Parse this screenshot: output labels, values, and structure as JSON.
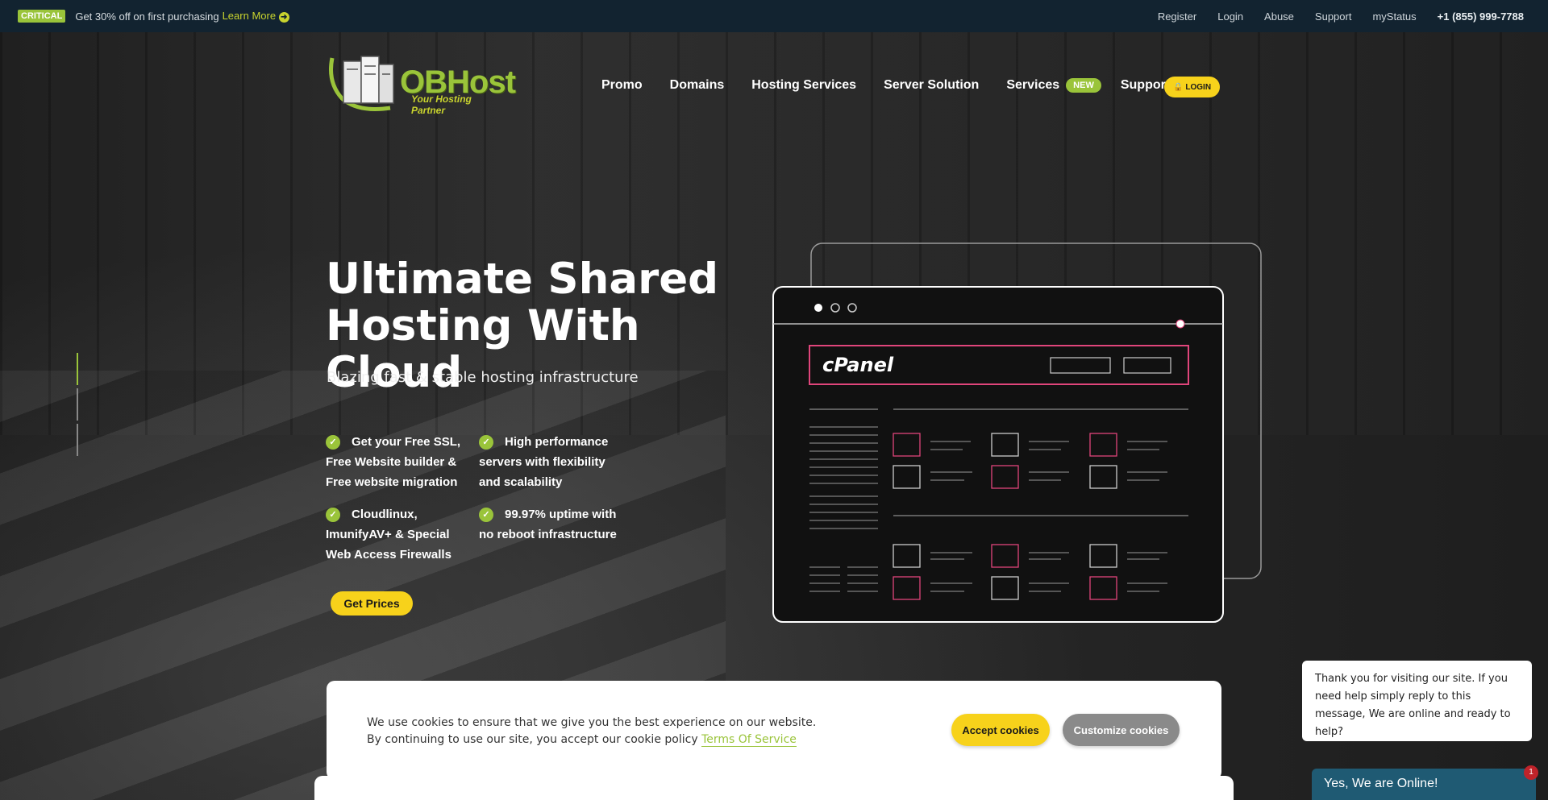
{
  "topbar": {
    "badge": "CRITICAL",
    "promo_text": "Get 30% off on first purchasing",
    "learn_more": "Learn More",
    "links": [
      "Register",
      "Login",
      "Abuse",
      "Support",
      "myStatus"
    ],
    "phone": "+1 (855) 999-7788"
  },
  "logo": {
    "brand": "OBHost",
    "tagline": "Your Hosting Partner"
  },
  "nav": {
    "items": [
      "Promo",
      "Domains",
      "Hosting Services",
      "Server Solution",
      "Services",
      "Support"
    ],
    "new_badge": "NEW",
    "login": "LOGIN"
  },
  "hero": {
    "title_line1": "Ultimate Shared",
    "title_line2": "Hosting With Cloud",
    "subtitle": "Blazing fast & stable hosting infrastructure",
    "features": [
      "Get your Free SSL, Free Website builder & Free website migration",
      "High performance servers with flexibility and scalability",
      "Cloudlinux, ImunifyAV+ & Special Web Access Firewalls",
      "99.97% uptime with no reboot infrastructure"
    ],
    "cta": "Get Prices"
  },
  "illustration": {
    "panel_brand": "cPanel"
  },
  "cookie": {
    "line1": "We use cookies to ensure that we give you the best experience on our website.",
    "line2": "By continuing to use our site, you accept our cookie policy",
    "tos": "Terms Of Service",
    "accept": "Accept cookies",
    "customize": "Customize cookies"
  },
  "chat": {
    "message": "Thank you for visiting our site. If you need help simply reply to this message, We are online and ready to help?",
    "status": "Yes, We are Online!",
    "unread": "1"
  },
  "colors": {
    "accent_green": "#9ac43a",
    "accent_yellow": "#f7d21b",
    "topbar_bg": "#122330",
    "panel_pink": "#e0457b"
  }
}
